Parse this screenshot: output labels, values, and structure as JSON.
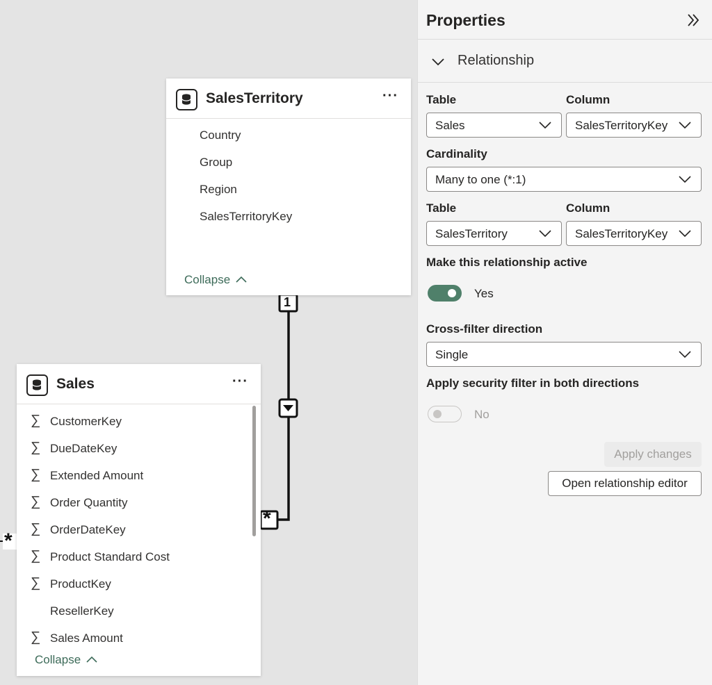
{
  "canvas": {
    "sales_territory_table": {
      "title": "SalesTerritory",
      "more_label": "···",
      "fields": [
        "Country",
        "Group",
        "Region",
        "SalesTerritoryKey"
      ],
      "collapse_label": "Collapse"
    },
    "sales_table": {
      "title": "Sales",
      "more_label": "···",
      "fields": [
        {
          "name": "CustomerKey",
          "sigma": "∑"
        },
        {
          "name": "DueDateKey",
          "sigma": "∑"
        },
        {
          "name": "Extended Amount",
          "sigma": "∑"
        },
        {
          "name": "Order Quantity",
          "sigma": "∑"
        },
        {
          "name": "OrderDateKey",
          "sigma": "∑"
        },
        {
          "name": "Product Standard Cost",
          "sigma": "∑"
        },
        {
          "name": "ProductKey",
          "sigma": "∑"
        },
        {
          "name": "ResellerKey",
          "sigma": ""
        },
        {
          "name": "Sales Amount",
          "sigma": "∑"
        }
      ],
      "collapse_label": "Collapse"
    },
    "relationship": {
      "one_marker": "1",
      "many_marker": "*",
      "offscreen_many_marker": "*"
    }
  },
  "properties": {
    "title": "Properties",
    "section_label": "Relationship",
    "table1_label": "Table",
    "column1_label": "Column",
    "table1_value": "Sales",
    "column1_value": "SalesTerritoryKey",
    "cardinality_label": "Cardinality",
    "cardinality_value": "Many to one (*:1)",
    "table2_label": "Table",
    "column2_label": "Column",
    "table2_value": "SalesTerritory",
    "column2_value": "SalesTerritoryKey",
    "active_label": "Make this relationship active",
    "active_value": "Yes",
    "crossfilter_label": "Cross-filter direction",
    "crossfilter_value": "Single",
    "security_label": "Apply security filter in both directions",
    "security_value": "No",
    "apply_button": "Apply changes",
    "open_editor_button": "Open relationship editor"
  },
  "colors": {
    "accent": "#4f806a",
    "collapse_link": "#3d6b59",
    "canvas": "#e4e4e4",
    "panel": "#f4f4f4"
  }
}
